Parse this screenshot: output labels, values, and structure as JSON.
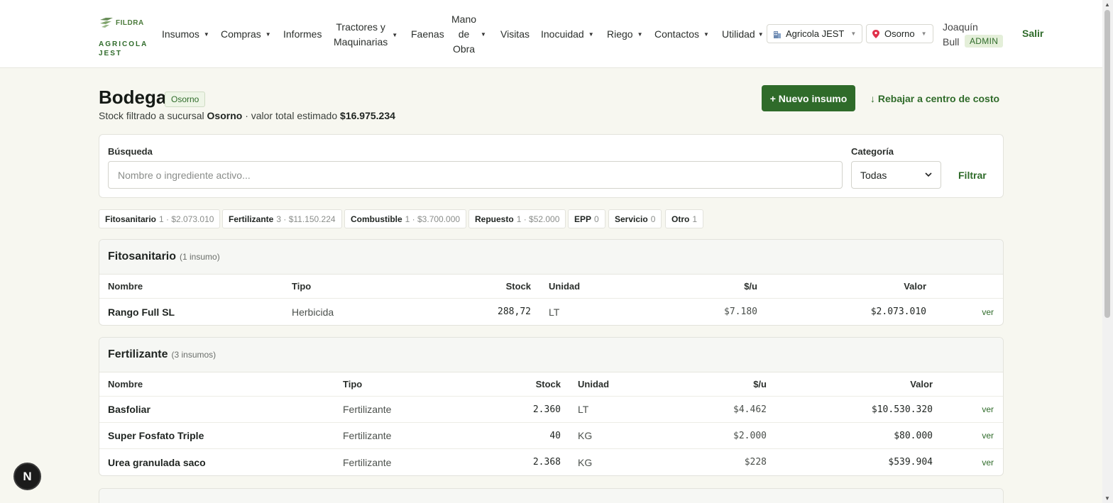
{
  "brand": {
    "logo_text": "FILDRA",
    "company_line1": "AGRICOLA",
    "company_line2": "JEST"
  },
  "nav": {
    "insumos": "Insumos",
    "compras": "Compras",
    "informes": "Informes",
    "tractores_1": "Tractores y",
    "tractores_2": "Maquinarias",
    "faenas": "Faenas",
    "mano_1": "Mano",
    "mano_2": "de",
    "mano_3": "Obra",
    "visitas": "Visitas",
    "inocuidad": "Inocuidad",
    "riego": "Riego",
    "contactos": "Contactos",
    "utilidad": "Utilidad"
  },
  "company_selector": {
    "label": "Agricola JEST"
  },
  "branch_selector": {
    "label": "Osorno"
  },
  "user": {
    "first_name": "Joaquín",
    "last_name": "Bull",
    "role": "ADMIN",
    "logout": "Salir"
  },
  "page": {
    "title": "Bodega",
    "branch_badge": "Osorno",
    "subtitle_prefix": "Stock filtrado a sucursal",
    "subtitle_branch": "Osorno",
    "subtitle_mid": "· valor total estimado",
    "subtitle_total": "$16.975.234",
    "new_button": "+ Nuevo insumo",
    "rebajar_link": "↓ Rebajar a centro de costo"
  },
  "filter": {
    "search_label": "Búsqueda",
    "search_placeholder": "Nombre o ingrediente activo...",
    "category_label": "Categoría",
    "category_value": "Todas",
    "filter_button": "Filtrar"
  },
  "chips": [
    {
      "name": "Fitosanitario",
      "meta": "1 · $2.073.010"
    },
    {
      "name": "Fertilizante",
      "meta": "3 · $11.150.224"
    },
    {
      "name": "Combustible",
      "meta": "1 · $3.700.000"
    },
    {
      "name": "Repuesto",
      "meta": "1 · $52.000"
    },
    {
      "name": "EPP",
      "meta": "0"
    },
    {
      "name": "Servicio",
      "meta": "0"
    },
    {
      "name": "Otro",
      "meta": "1"
    }
  ],
  "columns": {
    "nombre": "Nombre",
    "tipo": "Tipo",
    "stock": "Stock",
    "unidad": "Unidad",
    "precio": "$/u",
    "valor": "Valor",
    "ver": "ver"
  },
  "sections": [
    {
      "title": "Fitosanitario",
      "count": "(1 insumo)",
      "rows": [
        {
          "nombre": "Rango Full SL",
          "tipo": "Herbicida",
          "stock": "288,72",
          "unidad": "LT",
          "precio": "$7.180",
          "valor": "$2.073.010"
        }
      ]
    },
    {
      "title": "Fertilizante",
      "count": "(3 insumos)",
      "rows": [
        {
          "nombre": "Basfoliar",
          "tipo": "Fertilizante",
          "stock": "2.360",
          "unidad": "LT",
          "precio": "$4.462",
          "valor": "$10.530.320"
        },
        {
          "nombre": "Super Fosfato Triple",
          "tipo": "Fertilizante",
          "stock": "40",
          "unidad": "KG",
          "precio": "$2.000",
          "valor": "$80.000"
        },
        {
          "nombre": "Urea granulada saco",
          "tipo": "Fertilizante",
          "stock": "2.368",
          "unidad": "KG",
          "precio": "$228",
          "valor": "$539.904"
        }
      ]
    }
  ],
  "dev_badge": "N",
  "colors": {
    "accent": "#2f6b2a",
    "background": "#f7f7f0"
  }
}
